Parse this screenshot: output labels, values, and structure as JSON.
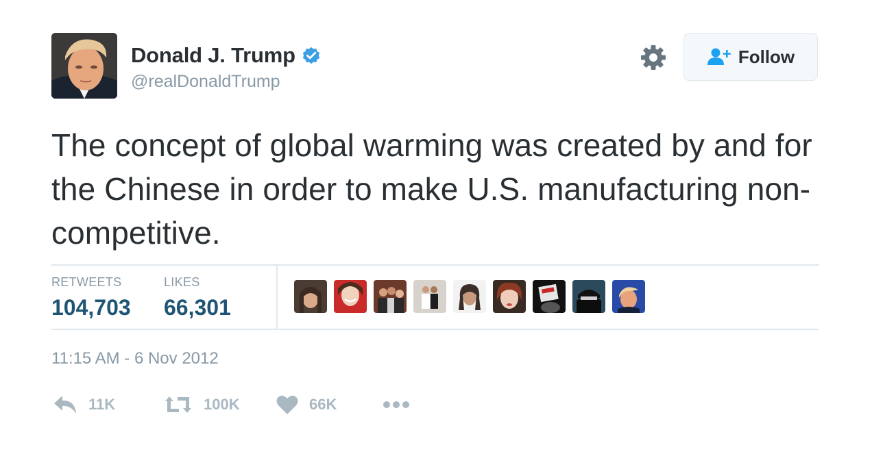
{
  "author": {
    "display_name": "Donald J. Trump",
    "handle": "@realDonaldTrump",
    "verified": true,
    "avatar_icon": "profile-photo"
  },
  "follow_button": {
    "label": "Follow",
    "icon": "add-user-icon"
  },
  "settings_icon": "gear-icon",
  "tweet": {
    "text": "The concept of global warming was created by and for the Chinese in order to make U.S. manufacturing non-competitive."
  },
  "stats": {
    "retweets_label": "RETWEETS",
    "retweets_value": "104,703",
    "likes_label": "LIKES",
    "likes_value": "66,301"
  },
  "likers_count_shown": 9,
  "timestamp": "11:15 AM - 6 Nov 2012",
  "actions": {
    "reply_count": "11K",
    "retweet_count": "100K",
    "like_count": "66K",
    "more_icon": "more-icon"
  },
  "colors": {
    "text": "#292f33",
    "muted": "#8899a6",
    "stat_number": "#1f5574",
    "verified_blue": "#3a9fe6",
    "follow_icon_blue": "#1da1f2",
    "action_gray": "#aab8c2",
    "border": "#e1e8ed"
  }
}
